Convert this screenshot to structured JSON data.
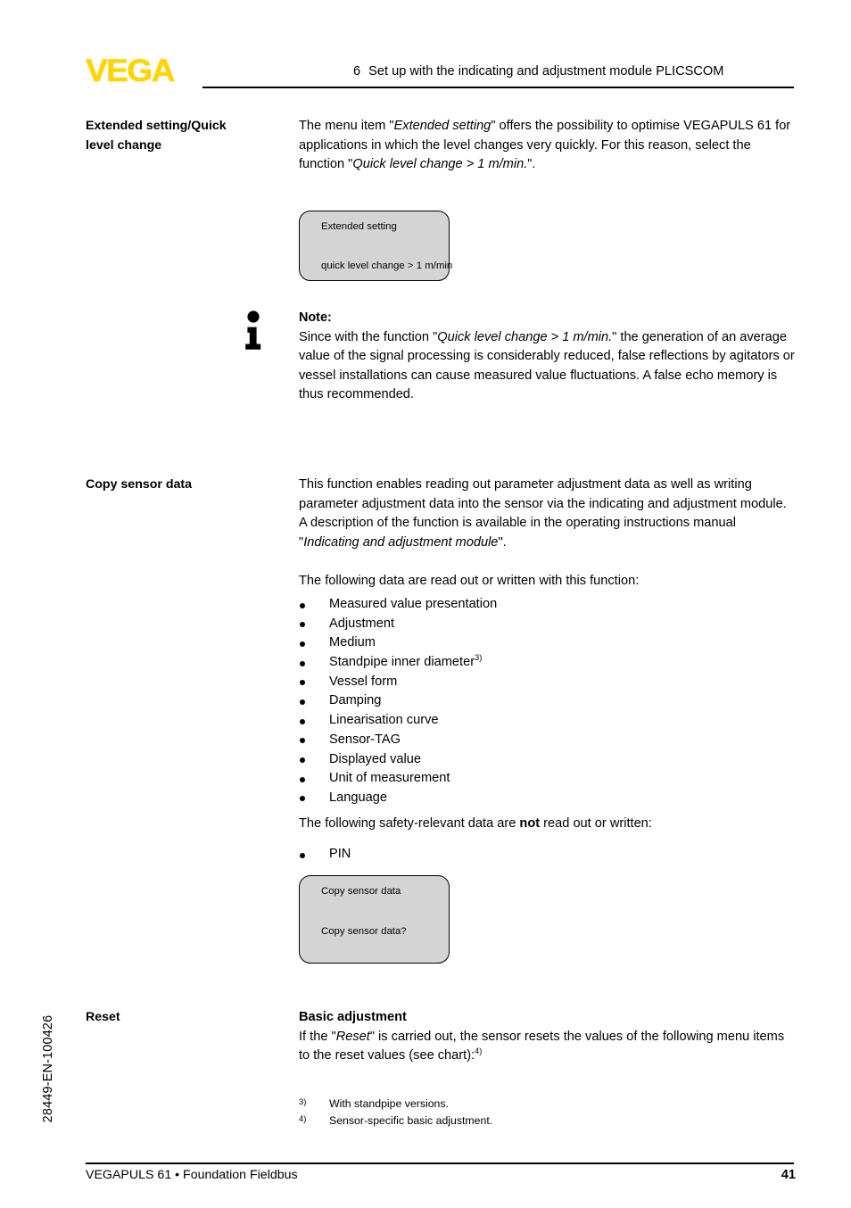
{
  "header": {
    "logo_text": "VEGA",
    "logo_color": "#FFD400",
    "section_number": "6",
    "section_title": "Set up with the indicating and adjustment module PLICSCOM"
  },
  "sections": {
    "extended_setting": {
      "margin_label_line1": "Extended setting/Quick",
      "margin_label_line2": "level change",
      "body_pre": "The menu item \"",
      "body_ital1": "Extended setting",
      "body_mid": "\" offers the possibility to optimise VEGAPULS 61 for applications in which the level changes very quickly. For this reason, select the function \"",
      "body_ital2": "Quick level change > 1 m/min.",
      "body_post": "\"."
    },
    "note": {
      "icon_name": "info-icon",
      "title": "Note:",
      "text_pre": "Since with the function \"",
      "text_ital": "Quick level change > 1 m/min.",
      "text_post": "\" the generation of an average value of the signal processing is considerably reduced, false reflections by agitators or vessel installations can cause measured value fluctuations. A false echo memory is thus recommended."
    },
    "copy_sensor_data": {
      "margin_label": "Copy sensor data",
      "para1_pre": "This function enables reading out parameter adjustment data as well as writing parameter adjustment data into the sensor via the indicating and adjustment module. A description of the function is available in the operating instructions manual \"",
      "para1_ital": "Indicating and adjustment module",
      "para1_post": "\".",
      "para2": "The following data are read out or written with this function:",
      "list_items": [
        {
          "label": "Measured value presentation",
          "footnote": ""
        },
        {
          "label": "Adjustment",
          "footnote": ""
        },
        {
          "label": "Medium",
          "footnote": ""
        },
        {
          "label": "Standpipe inner diameter",
          "footnote": "3)"
        },
        {
          "label": "Vessel form",
          "footnote": ""
        },
        {
          "label": "Damping",
          "footnote": ""
        },
        {
          "label": "Linearisation curve",
          "footnote": ""
        },
        {
          "label": "Sensor-TAG",
          "footnote": ""
        },
        {
          "label": "Displayed value",
          "footnote": ""
        },
        {
          "label": "Unit of measurement",
          "footnote": ""
        },
        {
          "label": "Language",
          "footnote": ""
        }
      ],
      "para3_pre": "The following safety-relevant data are ",
      "para3_bold": "not",
      "para3_post": " read out or written:",
      "list2_items": [
        {
          "label": "PIN",
          "footnote": ""
        }
      ]
    },
    "reset": {
      "margin_label": "Reset",
      "heading": "Basic adjustment",
      "text_pre": "If the \"",
      "text_ital": "Reset",
      "text_post": "\" is carried out, the sensor resets the values of the following menu items to the reset values (see chart):",
      "text_footnote": "4)"
    }
  },
  "displays": [
    {
      "name": "extended-setting-display",
      "top_line": "Extended setting",
      "bottom_line": "quick level change > 1 m/min",
      "background": "#D4D4D4"
    },
    {
      "name": "copy-sensor-data-display",
      "top_line": "Copy sensor data",
      "bottom_line": "Copy sensor data?",
      "background": "#D4D4D4"
    }
  ],
  "footnotes": [
    {
      "mark": "3)",
      "text": "With standpipe versions."
    },
    {
      "mark": "4)",
      "text": "Sensor-specific basic adjustment."
    }
  ],
  "footer": {
    "left": "VEGAPULS 61 • Foundation Fieldbus",
    "page_number": "41"
  },
  "side_code": "28449-EN-100426"
}
